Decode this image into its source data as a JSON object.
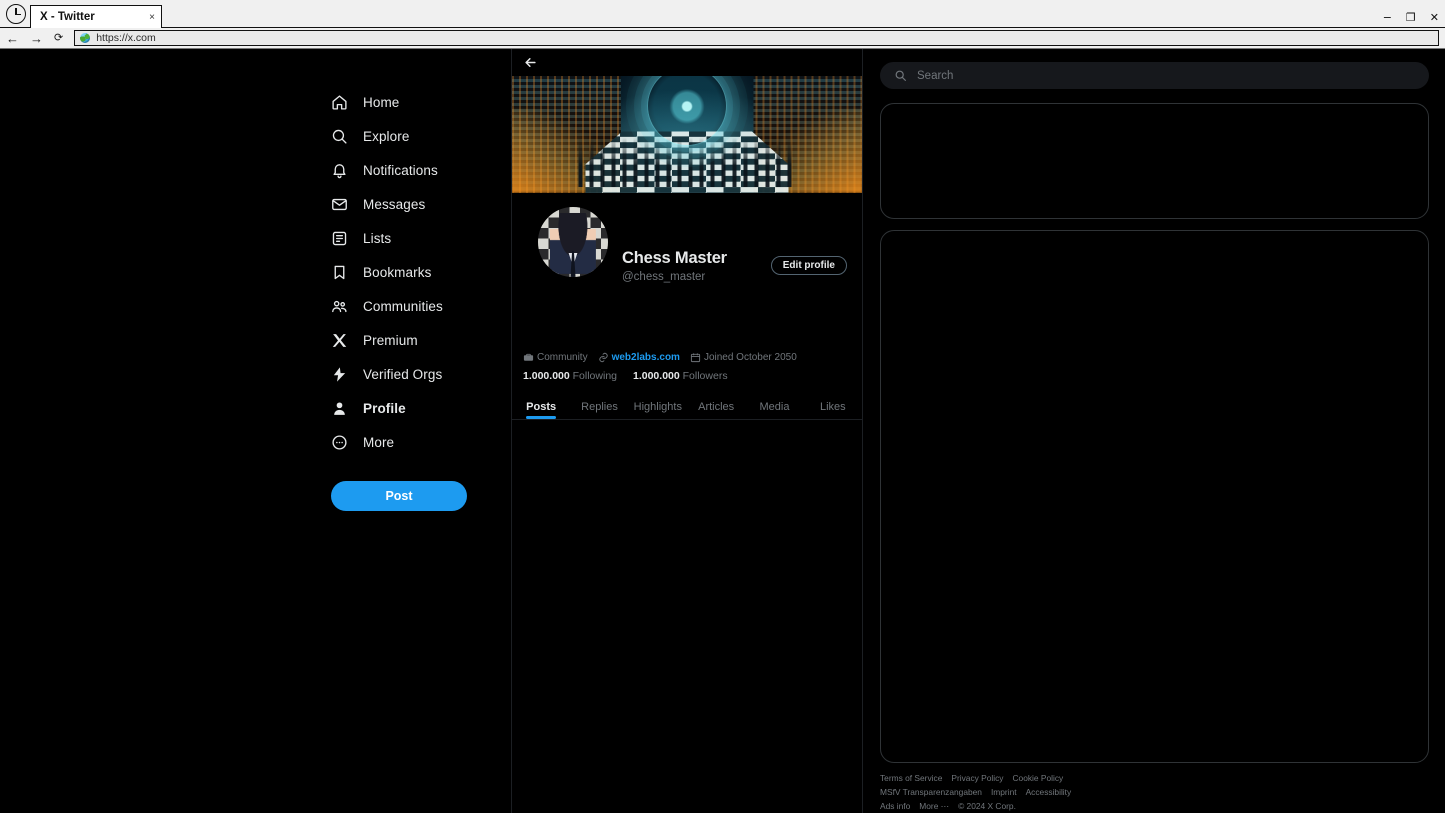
{
  "browser": {
    "tab_title": "X - Twitter",
    "tab_close": "×",
    "url": "https://x.com",
    "back_glyph": "←",
    "forward_glyph": "→",
    "reload_glyph": "⟳",
    "minimize_glyph": "−",
    "maximize_glyph": "❐",
    "close_glyph": "✕"
  },
  "sidebar": {
    "items": [
      {
        "label": "Home",
        "icon": "home-icon",
        "active": false
      },
      {
        "label": "Explore",
        "icon": "search-icon",
        "active": false
      },
      {
        "label": "Notifications",
        "icon": "bell-icon",
        "active": false
      },
      {
        "label": "Messages",
        "icon": "envelope-icon",
        "active": false
      },
      {
        "label": "Lists",
        "icon": "list-icon",
        "active": false
      },
      {
        "label": "Bookmarks",
        "icon": "bookmark-icon",
        "active": false
      },
      {
        "label": "Communities",
        "icon": "communities-icon",
        "active": false
      },
      {
        "label": "Premium",
        "icon": "x-logo-icon",
        "active": false
      },
      {
        "label": "Verified Orgs",
        "icon": "lightning-badge-icon",
        "active": false
      },
      {
        "label": "Profile",
        "icon": "person-icon",
        "active": true
      },
      {
        "label": "More",
        "icon": "more-circle-icon",
        "active": false
      }
    ],
    "post_button": "Post"
  },
  "profile": {
    "display_name": "Chess Master",
    "handle": "@chess_master",
    "edit_button": "Edit profile",
    "meta": {
      "community": "Community",
      "website": "web2labs.com",
      "joined": "Joined October 2050"
    },
    "stats": {
      "following_count": "1.000.000",
      "following_label": "Following",
      "followers_count": "1.000.000",
      "followers_label": "Followers"
    },
    "tabs": [
      {
        "label": "Posts",
        "active": true
      },
      {
        "label": "Replies",
        "active": false
      },
      {
        "label": "Highlights",
        "active": false
      },
      {
        "label": "Articles",
        "active": false
      },
      {
        "label": "Media",
        "active": false
      },
      {
        "label": "Likes",
        "active": false
      }
    ]
  },
  "search": {
    "placeholder": "Search",
    "value": ""
  },
  "footer": {
    "links": [
      "Terms of Service",
      "Privacy Policy",
      "Cookie Policy",
      "MSfV Transparenzangaben",
      "Imprint",
      "Accessibility",
      "Ads info",
      "More ⋯"
    ],
    "copyright": "© 2024 X Corp."
  },
  "colors": {
    "accent": "#1d9bf0",
    "text": "#e7e9ea",
    "muted": "#71767b",
    "border": "#2f3336"
  }
}
